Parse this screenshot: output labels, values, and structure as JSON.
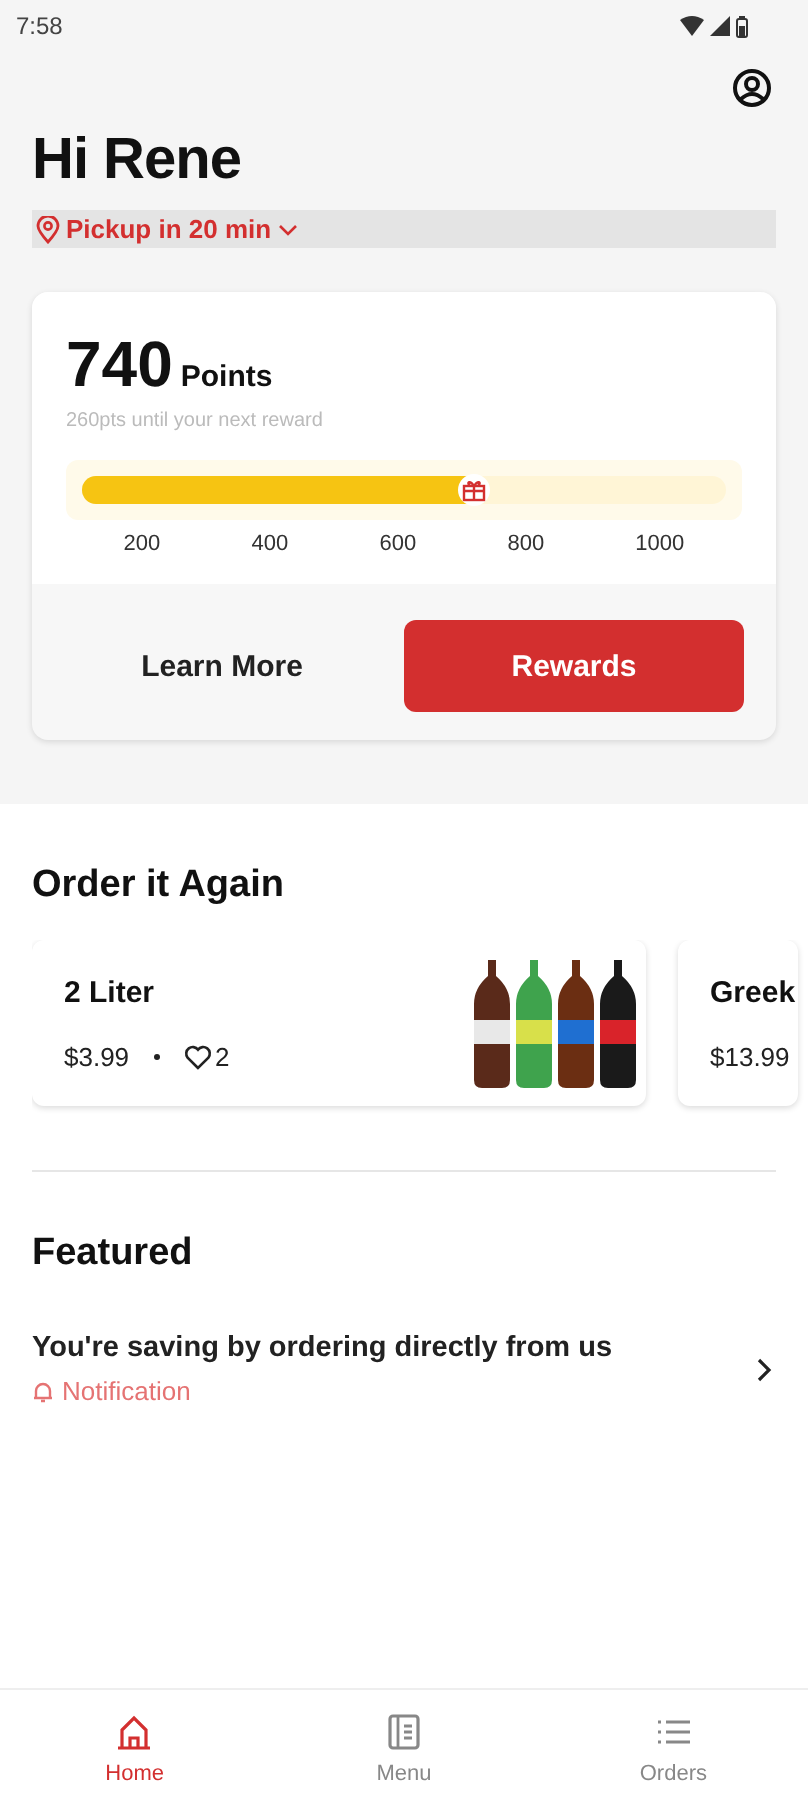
{
  "status_bar": {
    "time": "7:58"
  },
  "greeting": "Hi Rene",
  "pickup": {
    "label": "Pickup in 20 min"
  },
  "rewards": {
    "points": "740",
    "points_label": "Points",
    "subtitle": "260pts until your next reward",
    "level": 0.62,
    "ticks": [
      "200",
      "400",
      "600",
      "800",
      "1000"
    ],
    "buttons": [
      {
        "label": "Learn More",
        "kind": "text"
      },
      {
        "label": "Rewards",
        "kind": "primary"
      }
    ]
  },
  "order_again": {
    "title": "Order it Again",
    "items": [
      {
        "name": "2 Liter",
        "price": "$3.99",
        "likes": "2",
        "kind": "picture"
      },
      {
        "name": "Greek",
        "price": "$13.99"
      }
    ]
  },
  "featured": {
    "title": "Featured",
    "items": [
      {
        "title": "You're saving by ordering directly from us",
        "tag": "Notification"
      }
    ]
  },
  "nav": [
    {
      "label": "Home",
      "kind": "home",
      "selected": true
    },
    {
      "label": "Menu",
      "kind": "menu",
      "selected": false
    },
    {
      "label": "Orders",
      "kind": "orders",
      "selected": false
    }
  ]
}
